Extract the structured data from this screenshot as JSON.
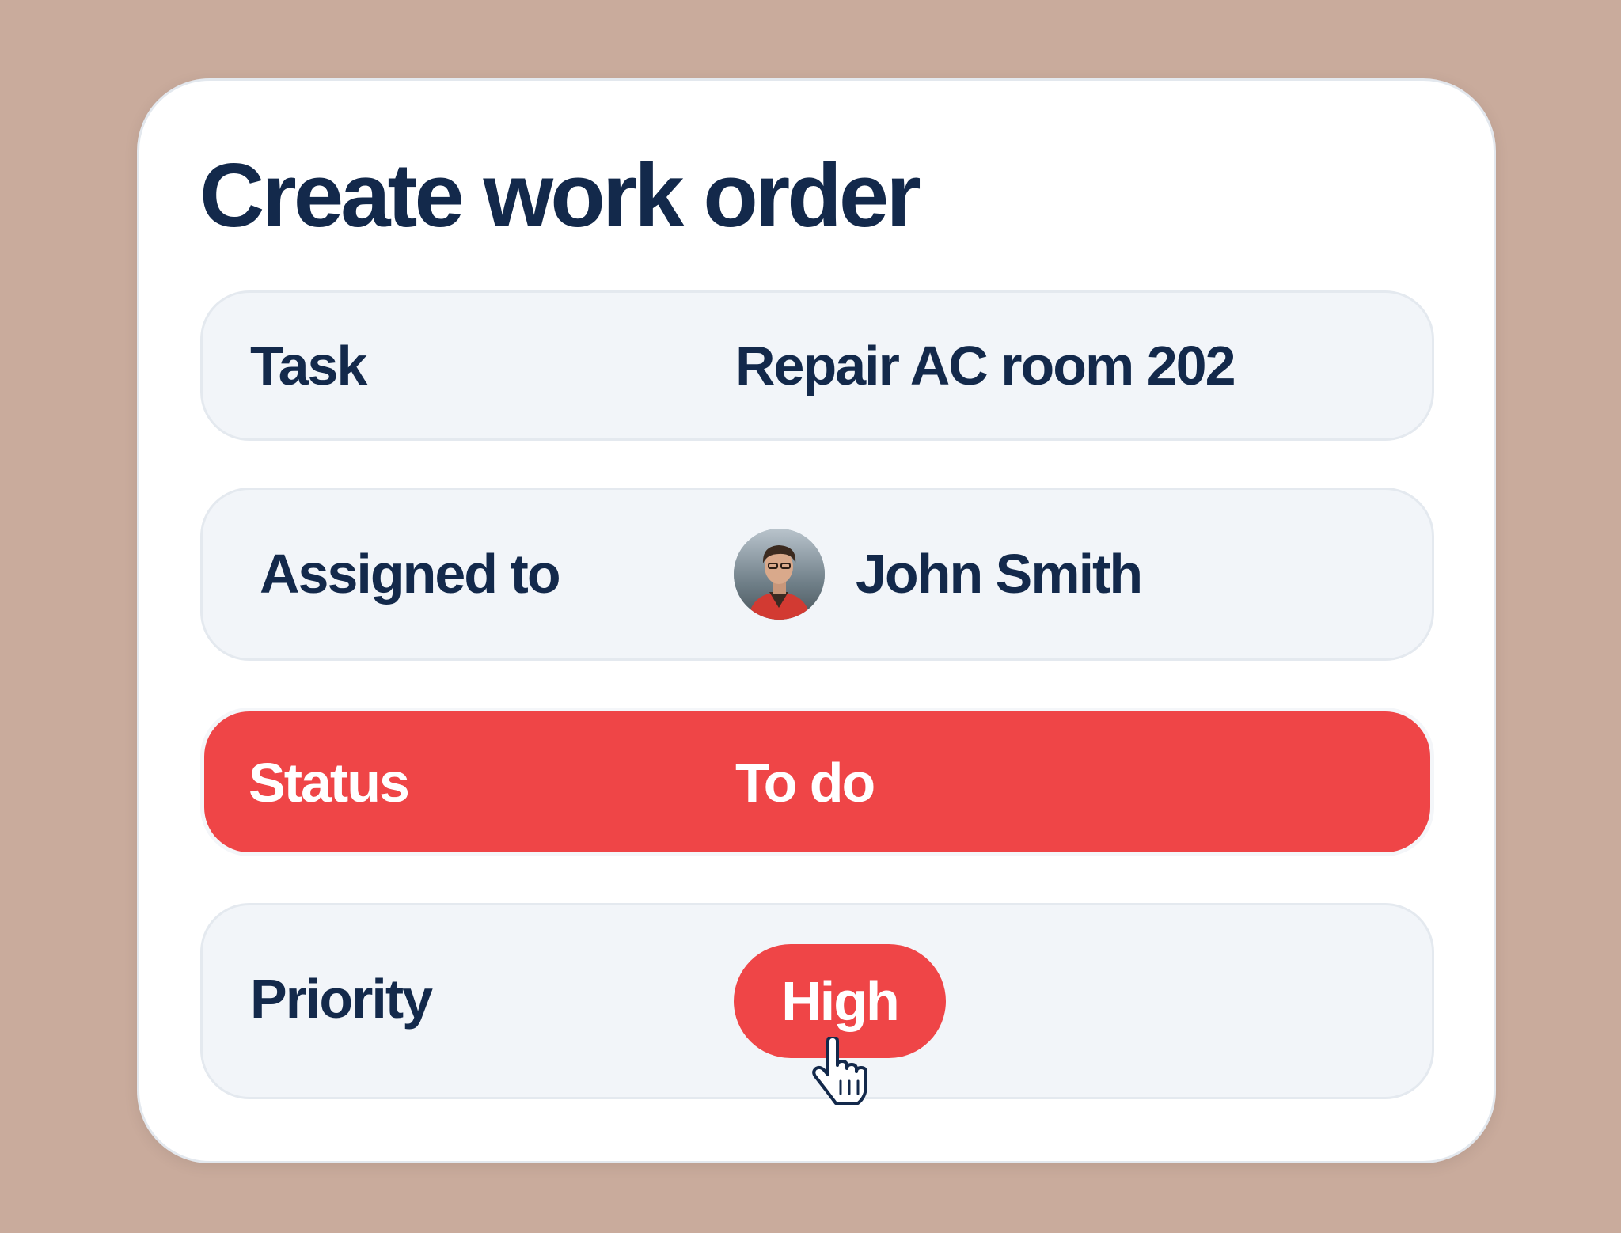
{
  "form": {
    "title": "Create work order",
    "fields": {
      "task": {
        "label": "Task",
        "value": "Repair AC room 202"
      },
      "assigned_to": {
        "label": "Assigned to",
        "value": "John Smith",
        "avatar_icon": "user-avatar"
      },
      "status": {
        "label": "Status",
        "value": "To do"
      },
      "priority": {
        "label": "Priority",
        "value": "High"
      }
    }
  },
  "colors": {
    "background": "#c9ab9c",
    "card": "#ffffff",
    "row": "#f2f5f9",
    "accent_red": "#ef4547",
    "text_navy": "#13294b"
  },
  "cursor_icon": "hand-pointer-icon"
}
